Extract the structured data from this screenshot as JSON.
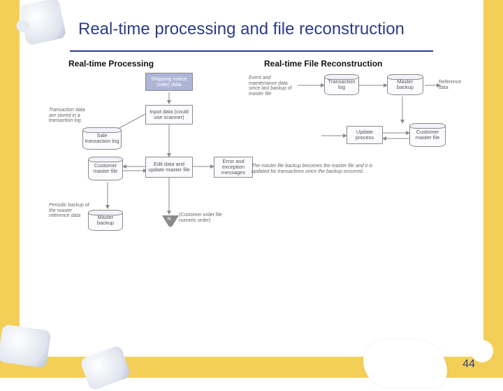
{
  "page": {
    "title": "Real-time processing and file reconstruction",
    "page_number": "44"
  },
  "left": {
    "subtitle": "Real-time Processing",
    "nodes": {
      "ship": "Shipping notice (sale) data",
      "input": "Input data (could use scanner)",
      "edit": "Edit data and update master file",
      "err": "Error and exception messages",
      "sale_log": "Sale transaction log",
      "cust_master": "Customer master file",
      "master_backup": "Master backup",
      "sort_label": "N",
      "sort_note": "(Customer order file numeric order)"
    },
    "notes": {
      "txn": "Transaction data are stored in a transaction log.",
      "backup": "Periodic backup of the master reference data"
    }
  },
  "right": {
    "subtitle": "Real-time File Reconstruction",
    "nodes": {
      "events": "Event and maintenance data since last backup of master file",
      "txn_log": "Transaction log",
      "master_backup": "Master backup",
      "ref_data": "Reference data",
      "update": "Update process",
      "cust_master": "Customer master file"
    },
    "notes": {
      "main": "The master file backup becomes the master file and it is updated for transactions since the backup occurred."
    }
  }
}
